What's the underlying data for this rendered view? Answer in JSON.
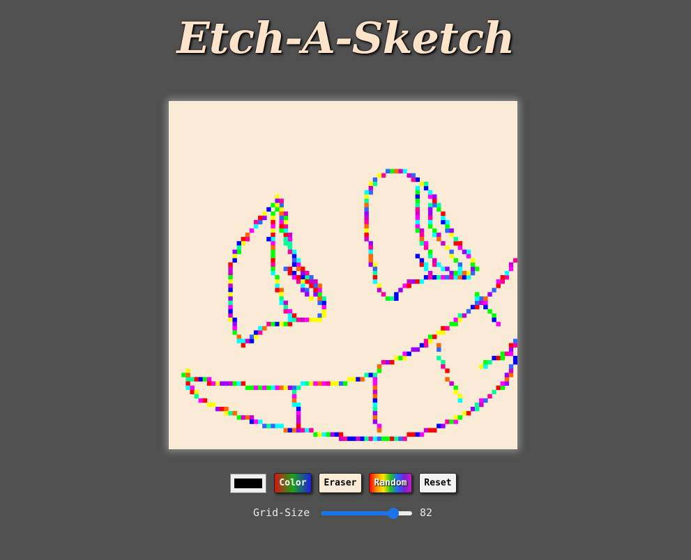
{
  "header": {
    "title": "Etch-A-Sketch"
  },
  "board": {
    "background": "#faebd7"
  },
  "controls": {
    "color_value": "#000000",
    "color_label": "Color",
    "eraser_label": "Eraser",
    "random_label": "Random",
    "reset_label": "Reset"
  },
  "grid": {
    "label": "Grid-Size",
    "value": "82",
    "slider_fraction": 0.79
  },
  "palette": [
    "#ff0000",
    "#00ff00",
    "#0000ff",
    "#ff00ff",
    "#00ffff",
    "#ffff00",
    "#9900ff",
    "#ff0099",
    "#00ff99",
    "#ff6600",
    "#3366ff",
    "#cc00cc"
  ]
}
